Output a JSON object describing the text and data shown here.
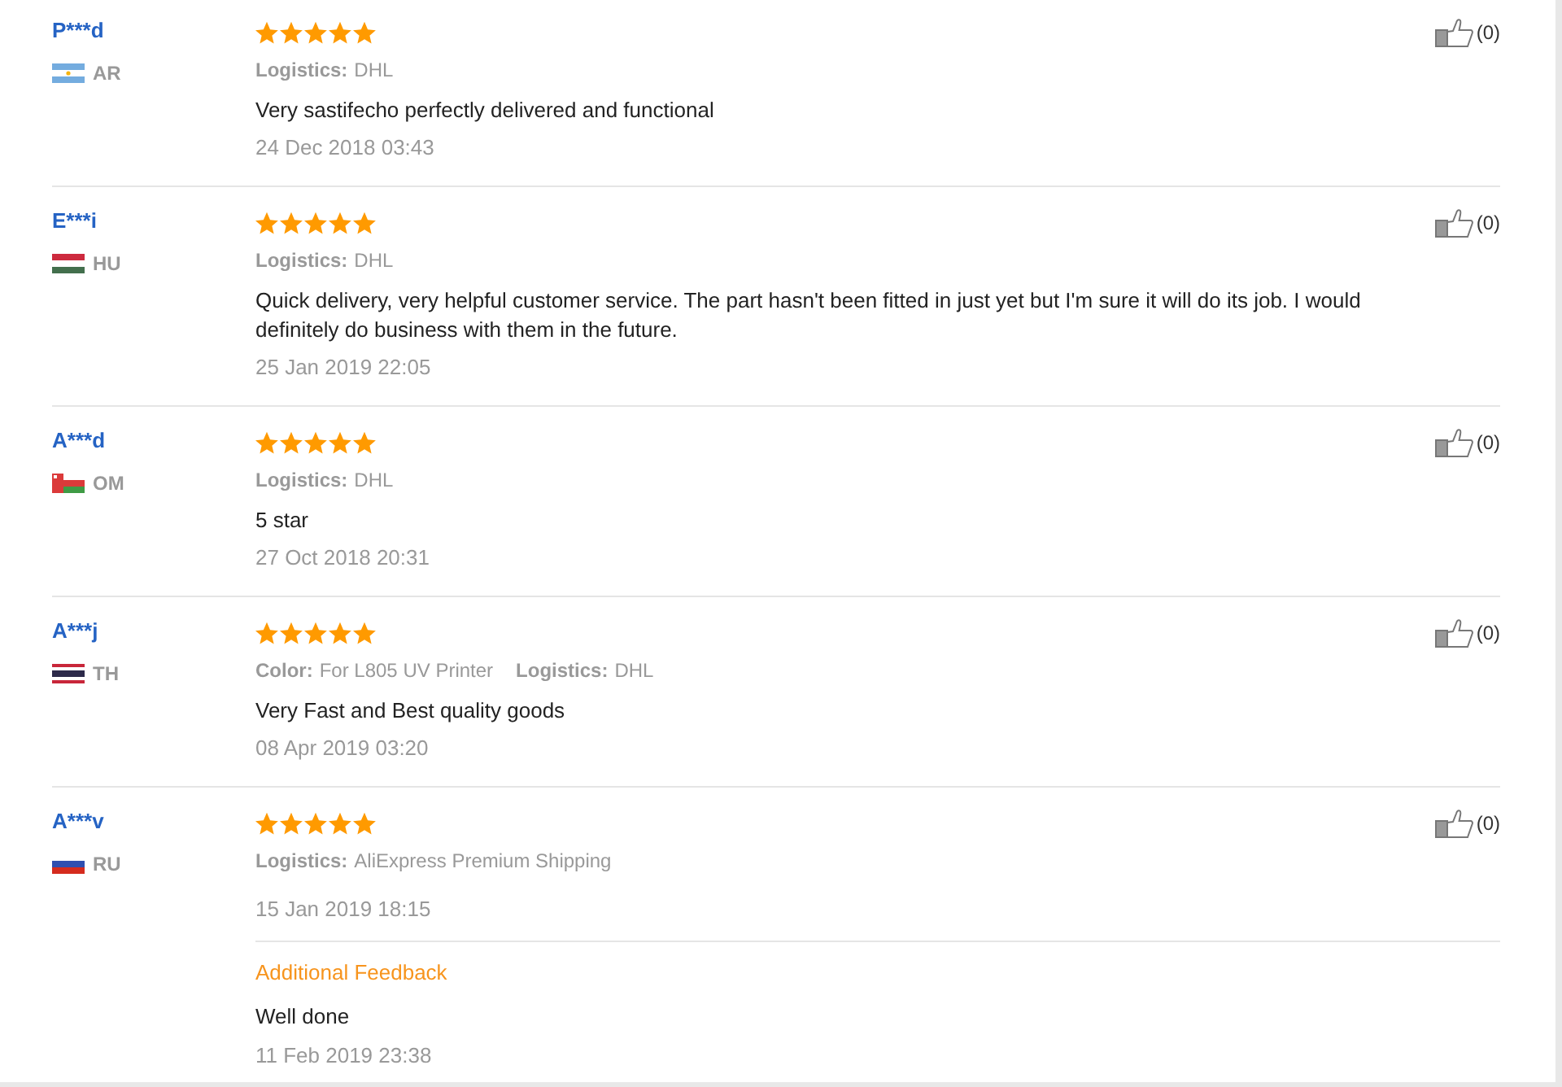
{
  "reviews": [
    {
      "name": "P***d",
      "flag": {
        "kind": "argentina"
      },
      "country": "AR",
      "stars": 5,
      "attributes": [
        {
          "label": "Logistics:",
          "value": "DHL"
        }
      ],
      "comment": "Very sastifecho perfectly delivered and functional",
      "date": "24 Dec 2018 03:43",
      "likes": "(0)"
    },
    {
      "name": "E***i",
      "flag": {
        "kind": "hungary"
      },
      "country": "HU",
      "stars": 5,
      "attributes": [
        {
          "label": "Logistics:",
          "value": "DHL"
        }
      ],
      "comment": "Quick delivery, very helpful customer service. The part hasn't been fitted in just yet but I'm sure it will do its job. I would definitely do business with them in the future.",
      "date": "25 Jan 2019 22:05",
      "likes": "(0)"
    },
    {
      "name": "A***d",
      "flag": {
        "kind": "oman"
      },
      "country": "OM",
      "stars": 5,
      "attributes": [
        {
          "label": "Logistics:",
          "value": "DHL"
        }
      ],
      "comment": "5 star",
      "date": "27 Oct 2018 20:31",
      "likes": "(0)"
    },
    {
      "name": "A***j",
      "flag": {
        "kind": "thailand"
      },
      "country": "TH",
      "stars": 5,
      "attributes": [
        {
          "label": "Color:",
          "value": "For L805 UV Printer"
        },
        {
          "label": "Logistics:",
          "value": "DHL"
        }
      ],
      "comment": "Very Fast and Best quality goods",
      "date": "08 Apr 2019 03:20",
      "likes": "(0)"
    },
    {
      "name": "A***v",
      "flag": {
        "kind": "russia"
      },
      "country": "RU",
      "stars": 5,
      "attributes": [
        {
          "label": "Logistics:",
          "value": "AliExpress Premium Shipping"
        }
      ],
      "date": "15 Jan 2019 18:15",
      "likes": "(0)",
      "additional_feedback": {
        "title": "Additional Feedback",
        "text": "Well done",
        "date": "11 Feb 2019 23:38"
      }
    }
  ]
}
